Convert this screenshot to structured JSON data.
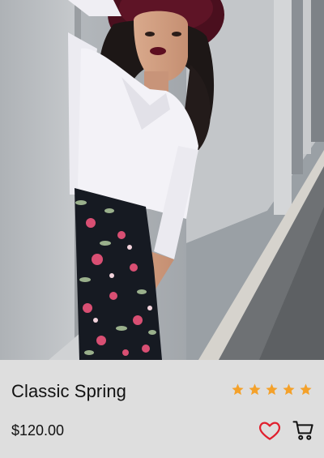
{
  "product": {
    "image_alt": "Woman wearing a burgundy wide-brim hat, white shirt and black floral skirt leaning on a grey wall",
    "name": "Classic Spring",
    "price": "$120.00",
    "rating": 5,
    "rating_max": 5
  },
  "actions": {
    "favorite_icon": "heart-outline-icon",
    "cart_icon": "shopping-cart-icon"
  },
  "colors": {
    "panel_bg": "#dedede",
    "star": "#f4a12a",
    "heart": "#e0202e",
    "text": "#111111"
  }
}
